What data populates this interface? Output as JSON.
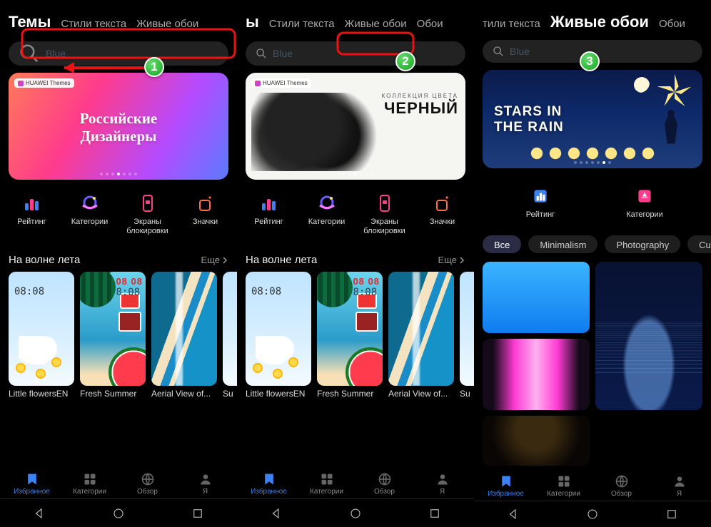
{
  "panels": [
    {
      "tabs": [
        "Темы",
        "Стили текста",
        "Живые обои"
      ],
      "activeTab": 0,
      "search": "Blue",
      "hero": {
        "badge": "HUAWEI Themes",
        "line1": "Российские",
        "line2": "Дизайнеры"
      },
      "section": {
        "title": "На волне лета",
        "more": "Еще"
      },
      "cards": [
        "Little flowersEN",
        "Fresh Summer",
        "Aerial View of...",
        "Su"
      ]
    },
    {
      "tabs": [
        "ы",
        "Стили текста",
        "Живые обои",
        "Обои"
      ],
      "activeTab": 0,
      "search": "Blue",
      "hero": {
        "badge": "HUAWEI Themes",
        "sub": "КОЛЛЕКЦИЯ ЦВЕТА",
        "main": "ЧЕРНЫЙ"
      },
      "section": {
        "title": "На волне лета",
        "more": "Еще"
      },
      "cards": [
        "Little flowersEN",
        "Fresh Summer",
        "Aerial View of...",
        "Su"
      ]
    },
    {
      "tabs": [
        "тили текста",
        "Живые обои",
        "Обои"
      ],
      "activeTab": 1,
      "search": "Blue",
      "hero": {
        "line1": "STARS IN",
        "line2": "THE RAIN"
      },
      "chips": [
        "Все",
        "Minimalism",
        "Photography",
        "Cute"
      ]
    }
  ],
  "quick": {
    "rating": "Рейтинг",
    "categories": "Категории",
    "lockscreens": "Экраны блокировки",
    "icons": "Значки"
  },
  "bottom": {
    "fav": "Избранное",
    "cat": "Категории",
    "review": "Обзор",
    "me": "Я"
  },
  "clock": "08:08",
  "summerDate": "08  08",
  "summerTime": "8:08"
}
